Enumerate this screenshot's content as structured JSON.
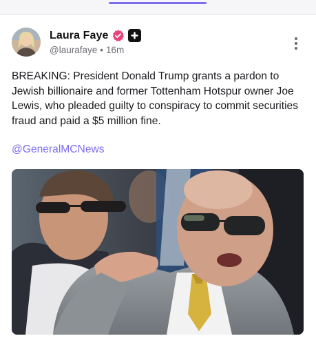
{
  "post": {
    "author": {
      "display_name": "Laura Faye",
      "handle": "@laurafaye",
      "separator": "•",
      "time": "16m",
      "avatar_icon": "avatar-photo",
      "verified_icon": "verified-badge-icon",
      "plus_icon": "plus-badge-icon"
    },
    "text": "BREAKING: President Donald Trump grants a pardon to Jewish billionaire and former Tottenham Hotspur owner Joe Lewis, who pleaded guilty to conspiracy to commit securities fraud and paid a $5 million fine.",
    "mention": "@GeneralMCNews",
    "menu_icon": "more-vertical-icon",
    "media_icon": "photo"
  },
  "colors": {
    "accent": "#7b6cf0",
    "verified": "#e8437a",
    "text": "#1b1b1f",
    "muted": "#6b6b73"
  }
}
